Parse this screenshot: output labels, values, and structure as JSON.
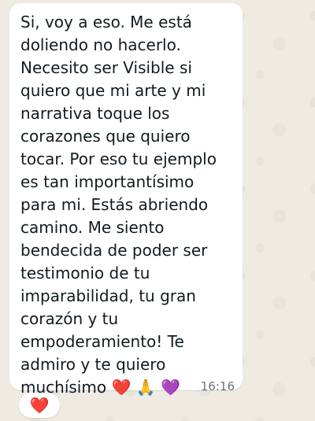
{
  "message": {
    "text": "Si, voy a eso. Me está doliendo no hacerlo. Necesito ser Visible si quiero que mi arte y mi narrativa toque los corazones que quiero tocar. Por eso tu ejemplo es tan importantísimo para mi. Estás abriendo camino. Me siento bendecida de poder ser testimonio de tu imparabilidad, tu gran corazón y tu empoderamiento! Te admiro y te quiero muchísimo",
    "emojis": "❤️ 🙏 💜",
    "timestamp": "16:16",
    "reaction": "❤️"
  },
  "colors": {
    "background": "#efeae2",
    "bubble": "#ffffff",
    "text": "#111b21",
    "timestamp": "#667781",
    "reaction": "#e11d48"
  }
}
